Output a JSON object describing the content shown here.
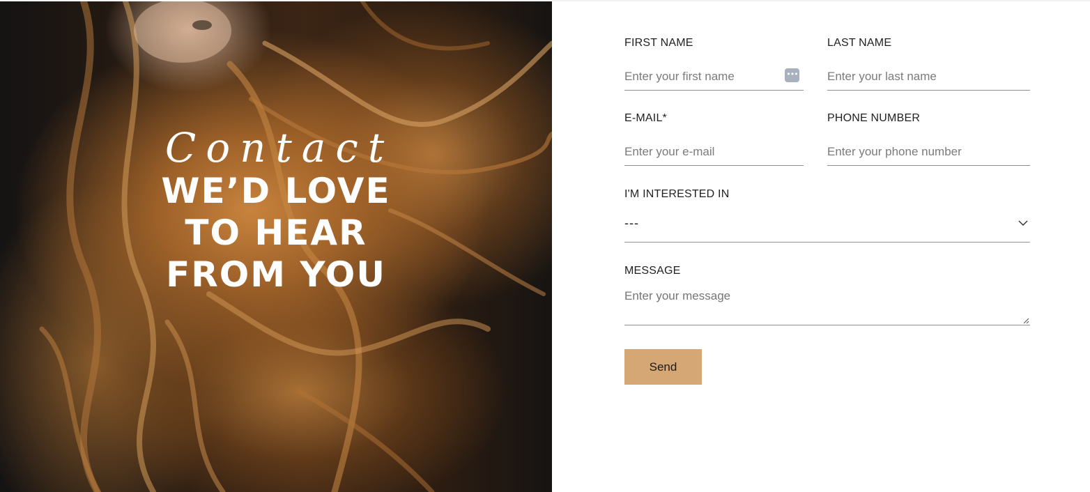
{
  "hero": {
    "script_title": "Contact",
    "headline": "WE’D LOVE TO HEAR FROM YOU"
  },
  "form": {
    "first_name": {
      "label": "FIRST NAME",
      "placeholder": "Enter your first name",
      "value": ""
    },
    "last_name": {
      "label": "LAST NAME",
      "placeholder": "Enter your last name",
      "value": ""
    },
    "email": {
      "label": "E-MAIL*",
      "placeholder": "Enter your e-mail",
      "value": ""
    },
    "phone": {
      "label": "PHONE NUMBER",
      "placeholder": "Enter your phone number",
      "value": ""
    },
    "interest": {
      "label": "I'M INTERESTED IN",
      "selected": "---"
    },
    "message": {
      "label": "MESSAGE",
      "placeholder": "Enter your message",
      "value": ""
    },
    "send_label": "Send"
  },
  "colors": {
    "accent": "#d5a774",
    "underline": "#8f8f8f",
    "autofill_icon": "#a9b1be"
  },
  "icons": {
    "autofill": "password-manager-icon",
    "select": "chevron-down-icon",
    "textarea": "resize-grip-icon"
  }
}
